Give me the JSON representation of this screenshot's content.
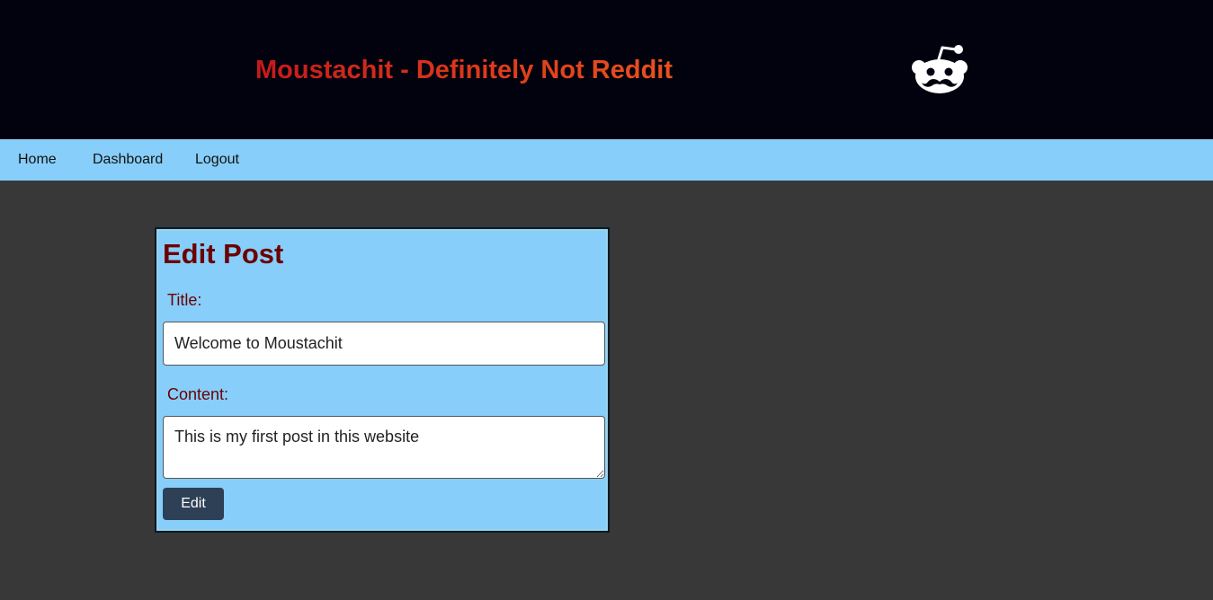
{
  "header": {
    "site_title": "Moustachit - Definitely Not Reddit",
    "logo_icon": "reddit-alien-moustache-icon"
  },
  "nav": {
    "items": [
      {
        "label": "Home"
      },
      {
        "label": "Dashboard"
      },
      {
        "label": "Logout"
      }
    ]
  },
  "form": {
    "heading": "Edit Post",
    "title_label": "Title:",
    "title_value": "Welcome to Moustachit",
    "content_label": "Content:",
    "content_value": "This is my first post in this website",
    "submit_label": "Edit"
  },
  "colors": {
    "header_bg": "#01020d",
    "nav_bg": "#87cefa",
    "page_bg": "#383838",
    "card_bg": "#87cefa",
    "heading_text": "#6b0000",
    "button_bg": "#2d4056",
    "title_gradient": [
      "#c41a1a",
      "#e8521e"
    ]
  }
}
